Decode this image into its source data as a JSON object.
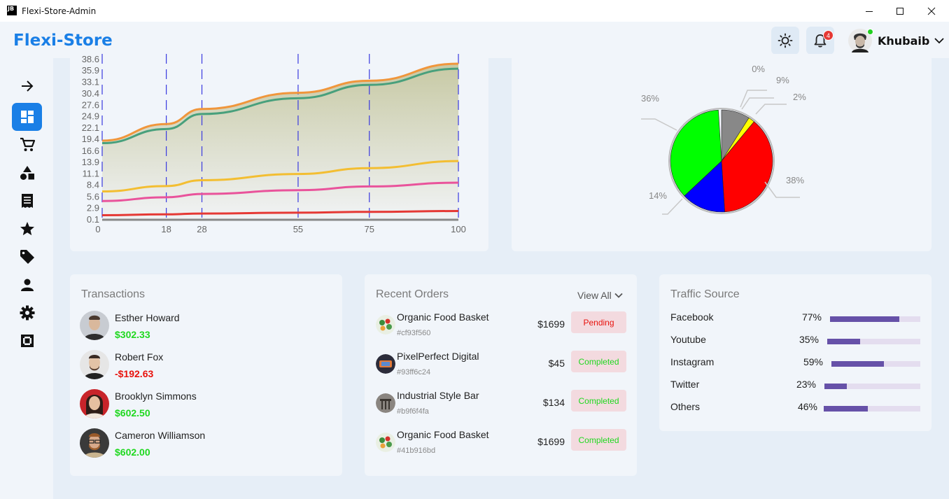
{
  "window": {
    "title": "Flexi-Store-Admin",
    "logo_text": "JB"
  },
  "header": {
    "brand": "Flexi-Store",
    "notification_count": "4",
    "user_name": "Khubaib"
  },
  "sidebar": {
    "items": [
      {
        "icon": "arrow-right-icon"
      },
      {
        "icon": "dashboard-icon",
        "active": true
      },
      {
        "icon": "cart-icon"
      },
      {
        "icon": "categories-icon"
      },
      {
        "icon": "receipt-icon"
      },
      {
        "icon": "star-icon"
      },
      {
        "icon": "tag-icon"
      },
      {
        "icon": "person-icon"
      },
      {
        "icon": "gear-icon"
      },
      {
        "icon": "fullscreen-icon"
      }
    ]
  },
  "chart_data": [
    {
      "type": "area",
      "x": [
        0,
        18,
        28,
        55,
        75,
        100
      ],
      "x_tick_labels": [
        "0",
        "18",
        "28",
        "55",
        "75",
        "100"
      ],
      "y_tick_labels": [
        "0.1",
        "2.9",
        "5.6",
        "8.4",
        "11.1",
        "13.9",
        "16.6",
        "19.4",
        "22.1",
        "24.9",
        "27.6",
        "30.4",
        "33.1",
        "35.9",
        "38.6"
      ],
      "ylim": [
        0.1,
        38.6
      ],
      "grid": "vertical dashed",
      "series": [
        {
          "color": "#f0963c",
          "values": [
            19.1,
            23.1,
            26.7,
            30.6,
            33.5,
            37.6
          ]
        },
        {
          "color": "#48a07c",
          "values": [
            18.5,
            21.9,
            25.5,
            29.3,
            32.5,
            36.4
          ]
        },
        {
          "color": "#f3be32",
          "values": [
            6.9,
            8.2,
            9.6,
            11.1,
            12.5,
            14.2
          ]
        },
        {
          "color": "#e9539b",
          "values": [
            4.6,
            5.5,
            6.3,
            7.2,
            8.1,
            9.0
          ]
        },
        {
          "color": "#e53935",
          "values": [
            1.2,
            1.4,
            1.6,
            1.8,
            2.0,
            2.2
          ]
        },
        {
          "color": "#888888",
          "values": [
            0.1,
            0.1,
            0.1,
            0.1,
            0.1,
            0.1
          ]
        }
      ]
    },
    {
      "type": "pie",
      "slices": [
        {
          "label": "38%",
          "value": 38,
          "color": "#ff0000"
        },
        {
          "label": "14%",
          "value": 14,
          "color": "#0000ff"
        },
        {
          "label": "36%",
          "value": 36,
          "color": "#00ff00"
        },
        {
          "label": "9%",
          "value": 9,
          "color": "#888888"
        },
        {
          "label": "2%",
          "value": 2,
          "color": "#ffff00"
        },
        {
          "label": "0%",
          "value": 0,
          "color": "#cccccc"
        }
      ]
    }
  ],
  "transactions": {
    "title": "Transactions",
    "items": [
      {
        "name": "Esther Howard",
        "amount": "$302.33",
        "color": "#1fd81f"
      },
      {
        "name": "Robert Fox",
        "amount": "-$192.63",
        "color": "#e8120c"
      },
      {
        "name": "Brooklyn Simmons",
        "amount": "$602.50",
        "color": "#1fd81f"
      },
      {
        "name": "Cameron Williamson",
        "amount": "$602.00",
        "color": "#1fd81f"
      }
    ]
  },
  "recent_orders": {
    "title": "Recent Orders",
    "view_all": "View All",
    "items": [
      {
        "name": "Organic Food Basket",
        "id": "#cf93f560",
        "price": "$1699",
        "status": "Pending",
        "status_color": "#e8120c"
      },
      {
        "name": "PixelPerfect Digital",
        "id": "#93ff6c24",
        "price": "$45",
        "status": "Completed",
        "status_color": "#1fd81f"
      },
      {
        "name": "Industrial Style Bar",
        "id": "#b9f6f4fa",
        "price": "$134",
        "status": "Completed",
        "status_color": "#1fd81f"
      },
      {
        "name": "Organic Food Basket",
        "id": "#41b916bd",
        "price": "$1699",
        "status": "Completed",
        "status_color": "#1fd81f"
      }
    ]
  },
  "traffic_source": {
    "title": "Traffic Source",
    "items": [
      {
        "label": "Facebook",
        "pct": "77%",
        "value": 0.77
      },
      {
        "label": "Youtube",
        "pct": "35%",
        "value": 0.35
      },
      {
        "label": "Instagram",
        "pct": "59%",
        "value": 0.59
      },
      {
        "label": "Twitter",
        "pct": "23%",
        "value": 0.23
      },
      {
        "label": "Others",
        "pct": "46%",
        "value": 0.46
      }
    ]
  }
}
